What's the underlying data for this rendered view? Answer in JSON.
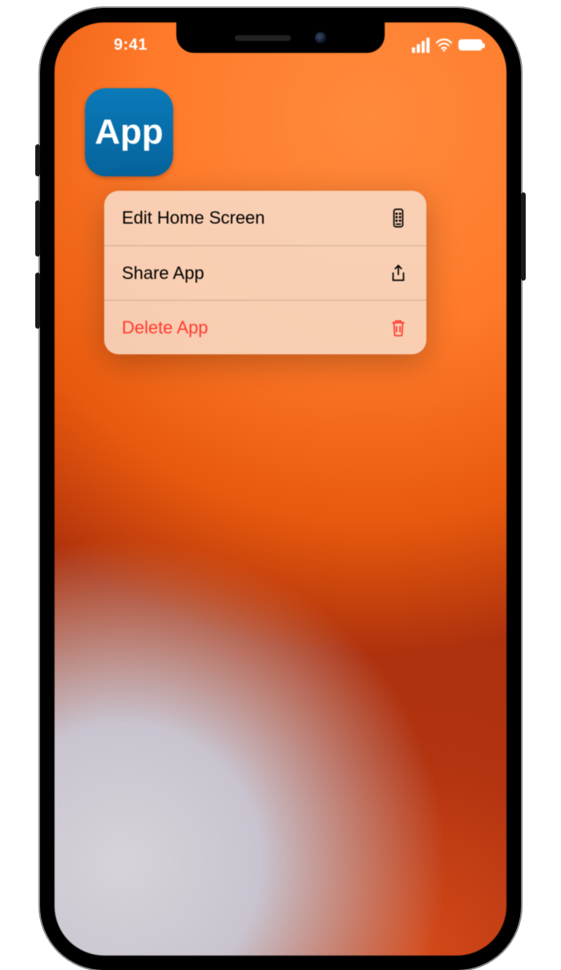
{
  "status_bar": {
    "time": "9:41"
  },
  "app_icon": {
    "label": "App"
  },
  "context_menu": {
    "items": [
      {
        "label": "Edit Home Screen",
        "icon": "edit-homescreen-icon",
        "destructive": false
      },
      {
        "label": "Share App",
        "icon": "share-icon",
        "destructive": false
      },
      {
        "label": "Delete App",
        "icon": "trash-icon",
        "destructive": true
      }
    ]
  },
  "colors": {
    "destructive": "#ff3b30",
    "app_icon_bg": "#0a7ab8"
  }
}
